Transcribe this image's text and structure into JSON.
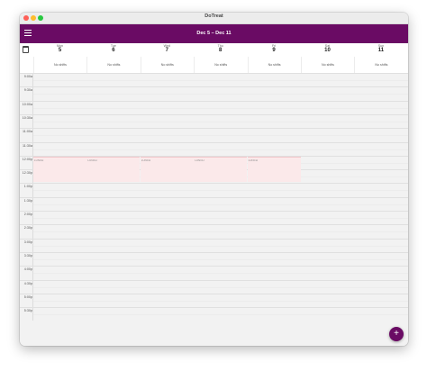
{
  "window": {
    "title": "DoTreat"
  },
  "appbar": {
    "date_range": "Dec 5 – Dec 11"
  },
  "days": [
    {
      "name": "Mon",
      "date": "5"
    },
    {
      "name": "Tue",
      "date": "6"
    },
    {
      "name": "Wed",
      "date": "7"
    },
    {
      "name": "Thu",
      "date": "8"
    },
    {
      "name": "Fri",
      "date": "9"
    },
    {
      "name": "Sat",
      "date": "10"
    },
    {
      "name": "Sun",
      "date": "11"
    }
  ],
  "shifts": [
    "No shifts",
    "No shifts",
    "No shifts",
    "No shifts",
    "No shifts",
    "No shifts",
    "No shifts"
  ],
  "times": [
    "9:00a",
    "9:30a",
    "10:00a",
    "10:30a",
    "11:00a",
    "11:30a",
    "12:00p",
    "12:30p",
    "1:00p",
    "1:30p",
    "2:00p",
    "2:30p",
    "3:00p",
    "3:30p",
    "4:00p",
    "4:30p",
    "5:00p",
    "5:30p"
  ],
  "lunch_label": "LUNCH",
  "fab": {
    "label": "+"
  }
}
